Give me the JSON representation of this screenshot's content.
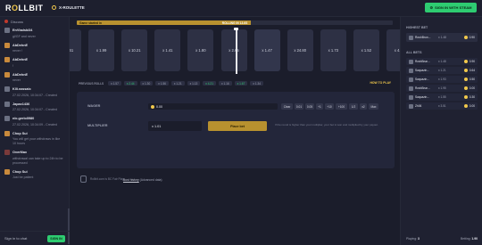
{
  "header": {
    "logo_main": "R",
    "logo_accent": "O",
    "logo_rest": "LLBIT",
    "game_title": "X-ROULETTE",
    "steam_button": "SIGN IN WITH STEAM"
  },
  "chat": {
    "channel": "Discuss",
    "messages": [
      {
        "user": "EnVladski34",
        "text": "gl/GF and never",
        "avatar": "gray"
      },
      {
        "user": "AbDehnE",
        "text": "never !",
        "avatar": "orange"
      },
      {
        "user": "AbDehnE",
        "text": "!",
        "avatar": "orange"
      },
      {
        "user": "AbDehnE",
        "text": "never",
        "avatar": "orange"
      },
      {
        "user": "Klli.ssssaic",
        "text": "27.02.2026, 10:34:07 - Created",
        "avatar": "gray"
      },
      {
        "user": "Japax1436",
        "text": "27.02.2026, 10:34:07 - Created",
        "avatar": "gray"
      },
      {
        "user": "nlc.gerlo0980",
        "text": "27.02.2026, 10:34:09 - Created",
        "avatar": "gray"
      },
      {
        "user": "Chop Sui",
        "text": "You will get your withdraws in like 10 hours",
        "avatar": "orange"
      },
      {
        "user": "OverMax",
        "text": "withdrawal can take up to 24h to be processed",
        "avatar": "red"
      },
      {
        "user": "Chop Sui",
        "text": "Just be patient",
        "avatar": "orange"
      }
    ],
    "sign_in_text": "Sign in to chat",
    "send_label": "SIGN IN"
  },
  "round": {
    "progress_left": "Game started in",
    "progress_center": "ROLLING IN 13.6S",
    "progress": 0.55
  },
  "reel": {
    "cards": [
      "x 1.61",
      "x 1.99",
      "x 10.21",
      "x 1.41",
      "x 1.80",
      "x 2.65",
      "x 1.47",
      "x 24.80",
      "x 1.73",
      "x 1.52",
      "x 4.21",
      "x 1.24",
      "x 1.15"
    ],
    "active_index": 6
  },
  "previous": {
    "label": "PREVIOUS ROLLS",
    "rolls": [
      {
        "v": "x 1.57",
        "c": "n"
      },
      {
        "v": "x 2.44",
        "c": "g"
      },
      {
        "v": "x 1.30",
        "c": "n"
      },
      {
        "v": "x 1.56",
        "c": "n"
      },
      {
        "v": "x 1.21",
        "c": "n"
      },
      {
        "v": "x 1.13",
        "c": "n"
      },
      {
        "v": "x 4.21",
        "c": "g"
      },
      {
        "v": "x 1.16",
        "c": "n"
      },
      {
        "v": "x 1.67",
        "c": "g"
      },
      {
        "v": "x 1.34",
        "c": "n"
      }
    ],
    "how_to_play": "HOW TO PLAY"
  },
  "wager": {
    "label": "WAGER",
    "value": "0.00",
    "buttons": [
      "Clear",
      "0.01",
      "0.05",
      "+1",
      "+10",
      "+100",
      "1/2",
      "x2",
      "Max"
    ]
  },
  "multiplier": {
    "label": "MULTIPLIER",
    "value": "x 1.01",
    "place_bet": "Place bet",
    "hint": "If the round is higher than your multiplier, your bet is won and multiplied by your payout."
  },
  "footer": {
    "badge": "Rollbit.com is BC Fair Play",
    "fair_link": "Bust history",
    "fair_rest": "(Advanced data)"
  },
  "sidebar": {
    "highest_title": "HIGHEST BET",
    "highest": {
      "name": "RoshBrun...",
      "mult": "x 1.48",
      "amount": "0.90"
    },
    "all_title": "ALL BETS",
    "bets": [
      {
        "name": "RoshBrun...",
        "mult": "x 1.48",
        "amount": "0.90"
      },
      {
        "name": "Saquazin...",
        "mult": "x 1.21",
        "amount": "0.64"
      },
      {
        "name": "Saquazin...",
        "mult": "x 1.93",
        "amount": "0.50"
      },
      {
        "name": "RoshBrun...",
        "mult": "x 1.95",
        "amount": "0.00"
      },
      {
        "name": "Saquazin...",
        "mult": "x 1.55",
        "amount": "0.30"
      },
      {
        "name": "Zh06",
        "mult": "x 3.51",
        "amount": "0.00"
      }
    ],
    "playing_label": "Playing:",
    "playing_value": "3",
    "betting_label": "Betting:",
    "betting_value": "1.90"
  }
}
